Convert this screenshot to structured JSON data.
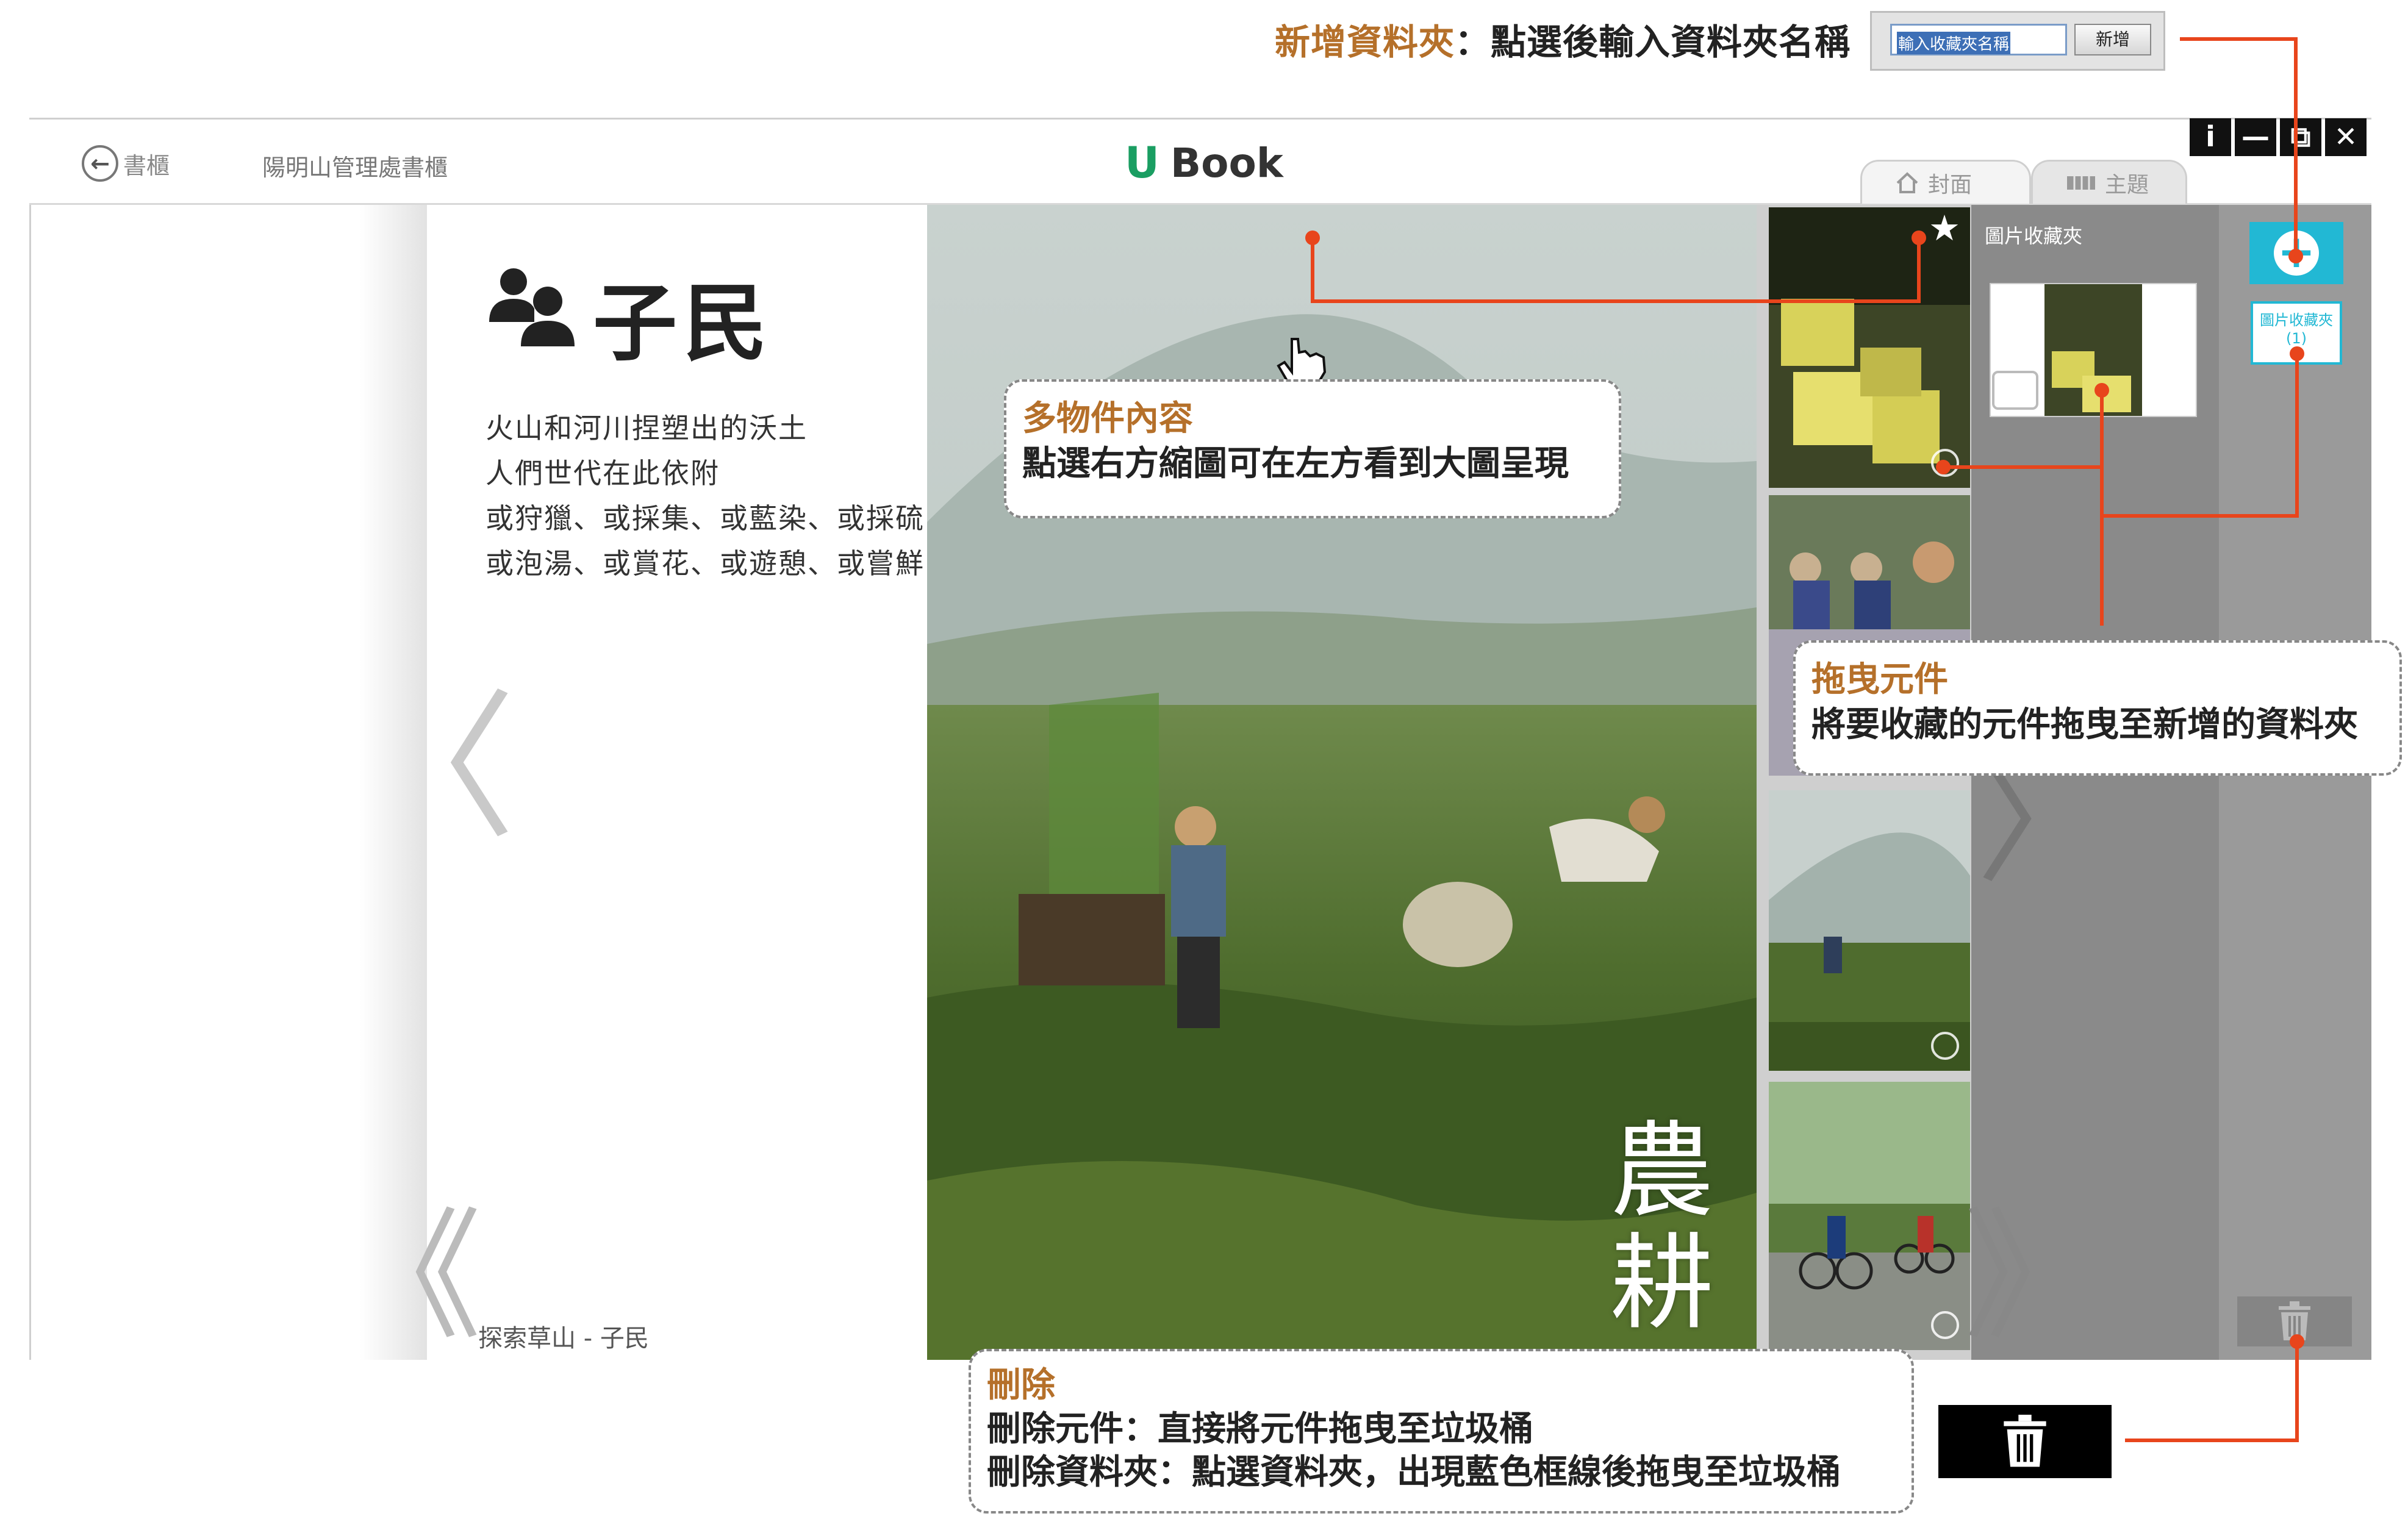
{
  "annotations": {
    "new_folder": {
      "title": "新增資料夾",
      "description": "：點選後輸入資料夾名稱",
      "input_value": "輸入收藏夾名稱",
      "button_label": "新增"
    },
    "multi_content": {
      "title": "多物件內容",
      "description": "點選右方縮圖可在左方看到大圖呈現"
    },
    "drag": {
      "title": "拖曳元件",
      "description": "將要收藏的元件拖曳至新增的資料夾"
    },
    "delete": {
      "title": "刪除",
      "line1": "刪除元件：直接將元件拖曳至垃圾桶",
      "line2": "刪除資料夾：點選資料夾，出現藍色框線後拖曳至垃圾桶"
    },
    "connector_color": "#e8451c",
    "accent_color": "#b5702a"
  },
  "header": {
    "back_label": "書櫃",
    "breadcrumb": "陽明山管理處書櫃",
    "brand_logo": "U",
    "brand_name": "Book",
    "brand_color": "#1a9e62",
    "window_controls": [
      "i",
      "—",
      "⧉",
      "✕"
    ]
  },
  "tabs": [
    {
      "label": "封面",
      "icon": "home-icon"
    },
    {
      "label": "主題",
      "icon": "grid-icon"
    }
  ],
  "page": {
    "title": "子民",
    "title_icon": "users-icon",
    "poem": [
      "火山和河川捏塑出的沃土",
      "人們世代在此依附",
      "或狩獵、或採集、或藍染、或採硫",
      "或泡湯、或賞花、或遊憩、或嘗鮮"
    ],
    "footer": "探索草山 - 子民",
    "photo_caption": "農耕"
  },
  "folder_panel": {
    "title": "圖片收藏夾",
    "folder_button_label": "圖片收藏夾",
    "folder_count": "(1)",
    "accent_color": "#22b8d4"
  }
}
